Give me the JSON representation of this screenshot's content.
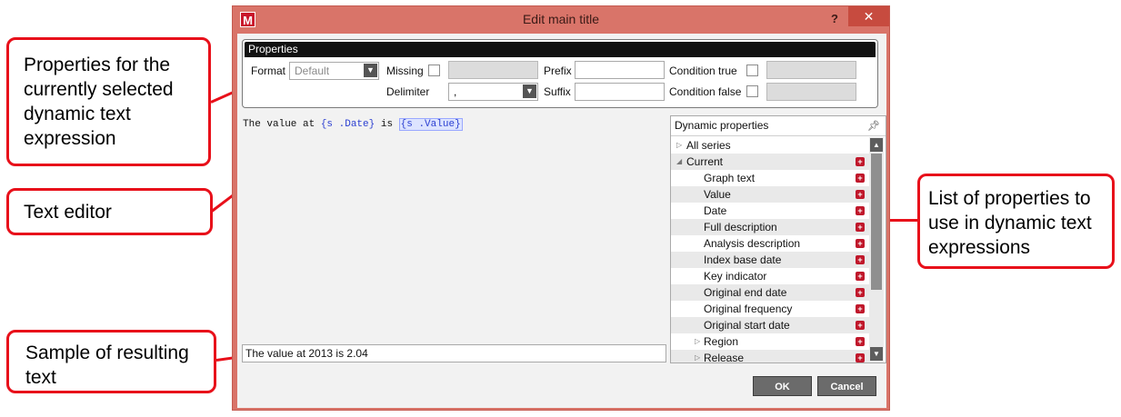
{
  "callouts": {
    "properties": "Properties for the currently selected dynamic text expression",
    "text_editor": "Text editor",
    "sample": "Sample of resulting text",
    "list": "List of properties to use in dynamic text expressions"
  },
  "window": {
    "title": "Edit main title",
    "logo_letter": "M",
    "help": "?",
    "close": "✕"
  },
  "properties": {
    "header": "Properties",
    "format_label": "Format",
    "format_value": "Default",
    "missing_label": "Missing",
    "delimiter_label": "Delimiter",
    "delimiter_value": ",",
    "prefix_label": "Prefix",
    "suffix_label": "Suffix",
    "condition_true_label": "Condition true",
    "condition_false_label": "Condition false"
  },
  "editor": {
    "part1": "The value at ",
    "token1": "{s .Date}",
    "part2": " is ",
    "token2": "{s .Value}"
  },
  "sample_text": "The value at 2013 is 2.04",
  "dynamic_properties": {
    "header": "Dynamic properties",
    "items": [
      {
        "label": "All series",
        "level": 0,
        "expander": "▷",
        "add": false
      },
      {
        "label": "Current",
        "level": 0,
        "expander": "◢",
        "add": true
      },
      {
        "label": "Graph text",
        "level": 2,
        "expander": "",
        "add": true
      },
      {
        "label": "Value",
        "level": 2,
        "expander": "",
        "add": true
      },
      {
        "label": "Date",
        "level": 2,
        "expander": "",
        "add": true
      },
      {
        "label": "Full description",
        "level": 2,
        "expander": "",
        "add": true
      },
      {
        "label": "Analysis description",
        "level": 2,
        "expander": "",
        "add": true
      },
      {
        "label": "Index base date",
        "level": 2,
        "expander": "",
        "add": true
      },
      {
        "label": "Key indicator",
        "level": 2,
        "expander": "",
        "add": true
      },
      {
        "label": "Original end date",
        "level": 2,
        "expander": "",
        "add": true
      },
      {
        "label": "Original frequency",
        "level": 2,
        "expander": "",
        "add": true
      },
      {
        "label": "Original start date",
        "level": 2,
        "expander": "",
        "add": true
      },
      {
        "label": "Region",
        "level": 1,
        "expander": "▷",
        "add": true
      },
      {
        "label": "Release",
        "level": 1,
        "expander": "▷",
        "add": true
      }
    ]
  },
  "buttons": {
    "ok": "OK",
    "cancel": "Cancel"
  }
}
